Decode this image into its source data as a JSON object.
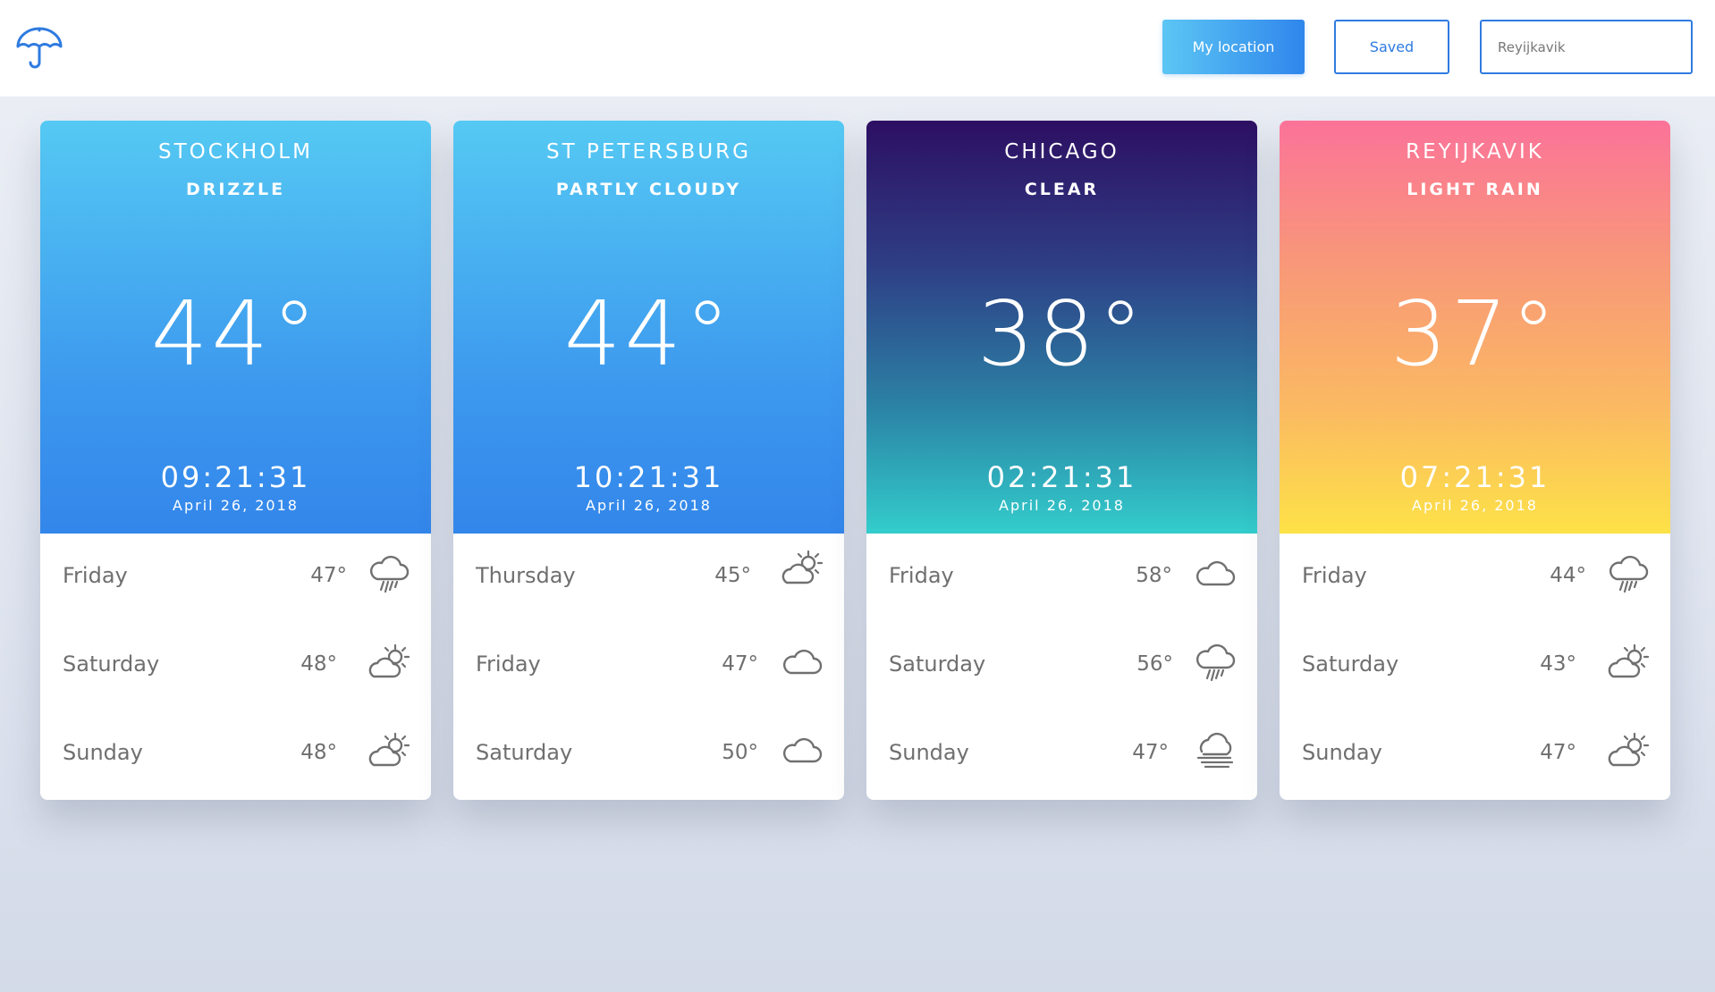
{
  "header": {
    "logo_icon": "umbrella-icon",
    "my_location_label": "My location",
    "saved_label": "Saved",
    "search_value": "Reyijkavik"
  },
  "cards": [
    {
      "city": "STOCKHOLM",
      "condition": "DRIZZLE",
      "temp": "44°",
      "time": "09:21:31",
      "date": "April 26, 2018",
      "forecast": [
        {
          "day": "Friday",
          "temp": "47°",
          "icon": "rain-cloud-icon"
        },
        {
          "day": "Saturday",
          "temp": "48°",
          "icon": "partly-cloudy-icon"
        },
        {
          "day": "Sunday",
          "temp": "48°",
          "icon": "partly-cloudy-icon"
        }
      ]
    },
    {
      "city": "ST PETERSBURG",
      "condition": "PARTLY CLOUDY",
      "temp": "44°",
      "time": "10:21:31",
      "date": "April 26, 2018",
      "forecast": [
        {
          "day": "Thursday",
          "temp": "45°",
          "icon": "partly-cloudy-icon"
        },
        {
          "day": "Friday",
          "temp": "47°",
          "icon": "cloud-icon"
        },
        {
          "day": "Saturday",
          "temp": "50°",
          "icon": "cloud-icon"
        }
      ]
    },
    {
      "city": "CHICAGO",
      "condition": "CLEAR",
      "temp": "38°",
      "time": "02:21:31",
      "date": "April 26, 2018",
      "forecast": [
        {
          "day": "Friday",
          "temp": "58°",
          "icon": "cloud-icon"
        },
        {
          "day": "Saturday",
          "temp": "56°",
          "icon": "rain-cloud-icon"
        },
        {
          "day": "Sunday",
          "temp": "47°",
          "icon": "fog-icon"
        }
      ]
    },
    {
      "city": "REYIJKAVIK",
      "condition": "LIGHT RAIN",
      "temp": "37°",
      "time": "07:21:31",
      "date": "April 26, 2018",
      "forecast": [
        {
          "day": "Friday",
          "temp": "44°",
          "icon": "rain-cloud-icon"
        },
        {
          "day": "Saturday",
          "temp": "43°",
          "icon": "partly-cloudy-icon"
        },
        {
          "day": "Sunday",
          "temp": "47°",
          "icon": "partly-cloudy-icon"
        }
      ]
    }
  ],
  "colors": {
    "accent": "#2f7be0",
    "text_gray": "#6f6f6f",
    "icon_gray": "#707070"
  }
}
